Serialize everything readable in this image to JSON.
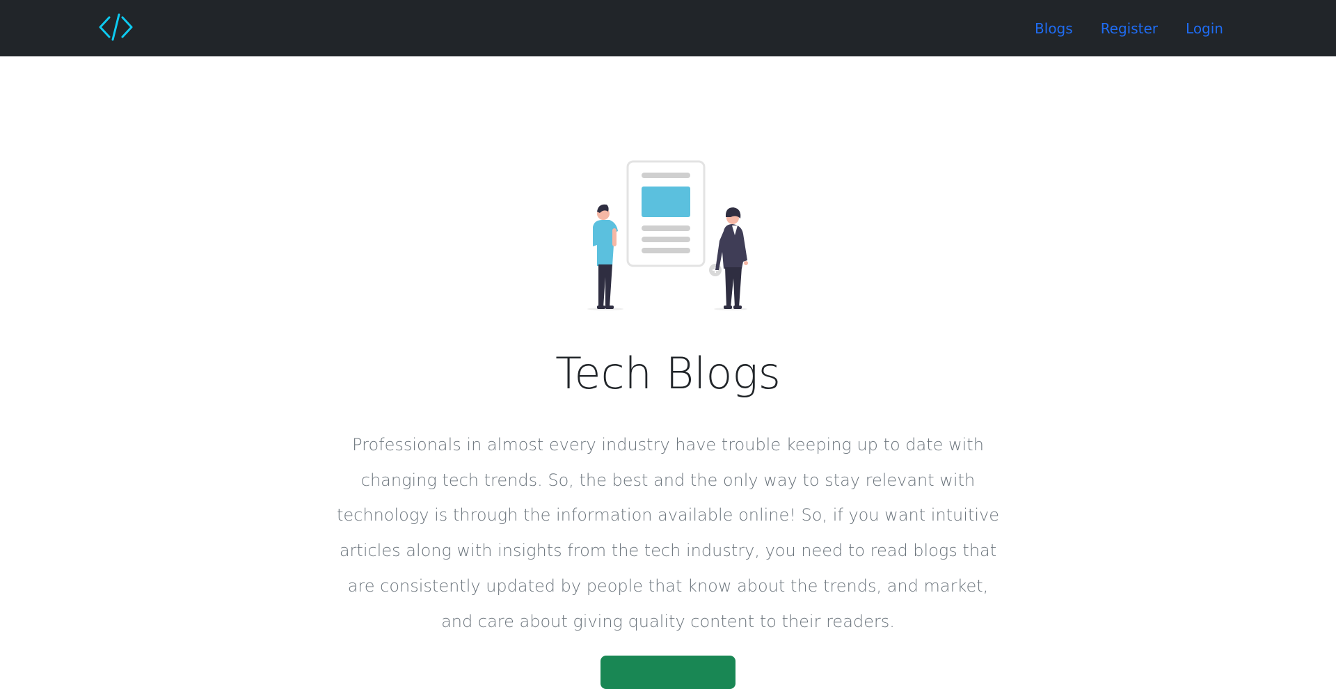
{
  "nav": {
    "logo_icon": "code-icon",
    "links": [
      "Blogs",
      "Register",
      "Login"
    ]
  },
  "hero": {
    "title": "Tech Blogs",
    "paragraph": "Professionals in almost every industry have trouble keeping up to date with changing tech trends. So, the best and the only way to stay relevant with technology is through the information available online! So, if you want intuitive articles along with insights from the tech industry, you need to read blogs that are consistently updated by people that know about the trends, and market, and care about giving quality content to their readers.",
    "illustration": "people-reading-article-illustration"
  },
  "colors": {
    "navbar_bg": "#212529",
    "link": "#1f6cf2",
    "logo": "#0dcaf0",
    "accent_blue": "#5bc0de",
    "button": "#198754"
  }
}
